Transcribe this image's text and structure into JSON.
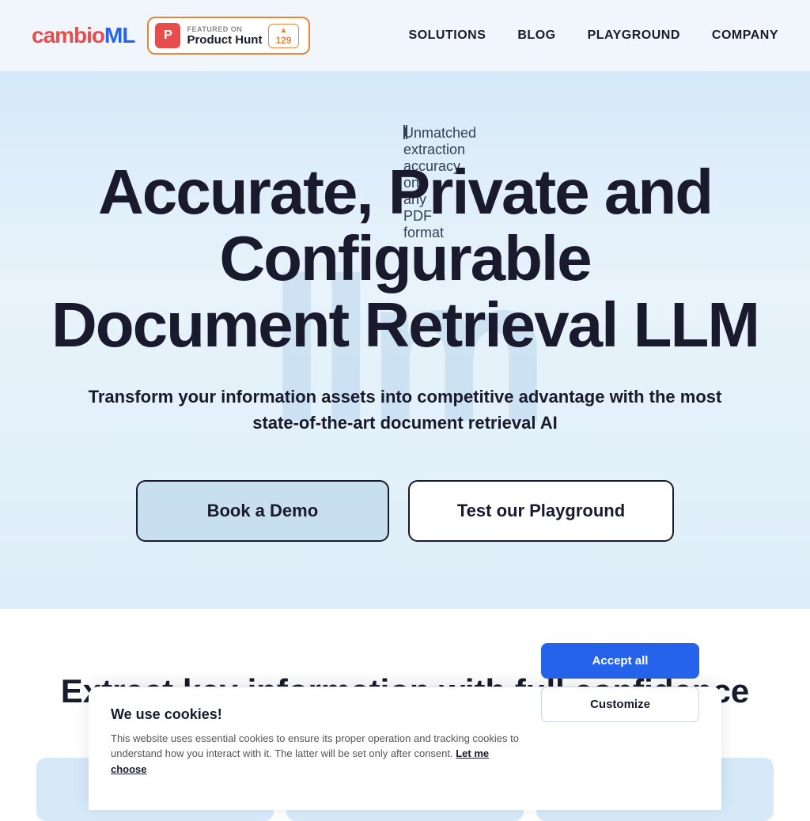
{
  "nav": {
    "logo_text": "cambio",
    "logo_ml": "ML",
    "ph_featured_label": "FEATURED ON",
    "ph_name": "Product Hunt",
    "ph_upvote_count": "129",
    "links": [
      {
        "label": "SOLUTIONS",
        "id": "solutions"
      },
      {
        "label": "BLOG",
        "id": "blog"
      },
      {
        "label": "PLAYGROUND",
        "id": "playground"
      },
      {
        "label": "COMPANY",
        "id": "company"
      }
    ]
  },
  "hero": {
    "bg_text": "llm",
    "tagline": "Unmatched extraction accuracy on any PDF format",
    "title_line1": "Accurate, Private and Configurable",
    "title_line2": "Document Retrieval LLM",
    "subtitle": "Transform your information assets into competitive advantage with the most state-of-the-art document retrieval AI",
    "btn_demo": "Book a Demo",
    "btn_playground": "Test our Playground"
  },
  "section": {
    "title": "Extract key information with full confidence"
  },
  "cookie": {
    "title": "We use cookies!",
    "text": "This website uses essential cookies to ensure its proper operation and tracking cookies to understand how you interact with it. The latter will be set only after consent.",
    "link_text": "Let me choose",
    "btn_accept": "Accept all",
    "btn_customize": "Customize"
  }
}
